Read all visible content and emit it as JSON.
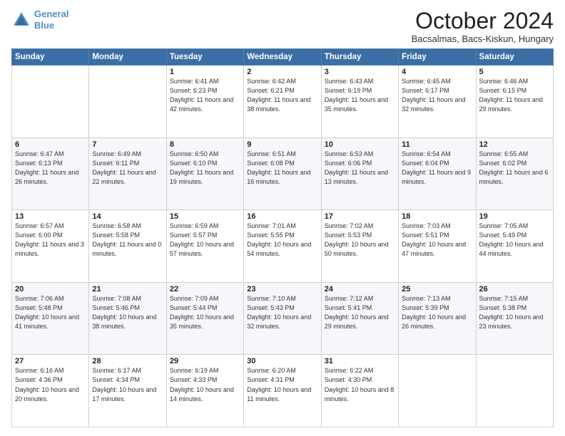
{
  "header": {
    "logo_line1": "General",
    "logo_line2": "Blue",
    "month": "October 2024",
    "location": "Bacsalmas, Bacs-Kiskun, Hungary"
  },
  "days_of_week": [
    "Sunday",
    "Monday",
    "Tuesday",
    "Wednesday",
    "Thursday",
    "Friday",
    "Saturday"
  ],
  "weeks": [
    [
      {
        "day": "",
        "text": ""
      },
      {
        "day": "",
        "text": ""
      },
      {
        "day": "1",
        "text": "Sunrise: 6:41 AM\nSunset: 6:23 PM\nDaylight: 11 hours and 42 minutes."
      },
      {
        "day": "2",
        "text": "Sunrise: 6:42 AM\nSunset: 6:21 PM\nDaylight: 11 hours and 38 minutes."
      },
      {
        "day": "3",
        "text": "Sunrise: 6:43 AM\nSunset: 6:19 PM\nDaylight: 11 hours and 35 minutes."
      },
      {
        "day": "4",
        "text": "Sunrise: 6:45 AM\nSunset: 6:17 PM\nDaylight: 11 hours and 32 minutes."
      },
      {
        "day": "5",
        "text": "Sunrise: 6:46 AM\nSunset: 6:15 PM\nDaylight: 11 hours and 29 minutes."
      }
    ],
    [
      {
        "day": "6",
        "text": "Sunrise: 6:47 AM\nSunset: 6:13 PM\nDaylight: 11 hours and 26 minutes."
      },
      {
        "day": "7",
        "text": "Sunrise: 6:49 AM\nSunset: 6:11 PM\nDaylight: 11 hours and 22 minutes."
      },
      {
        "day": "8",
        "text": "Sunrise: 6:50 AM\nSunset: 6:10 PM\nDaylight: 11 hours and 19 minutes."
      },
      {
        "day": "9",
        "text": "Sunrise: 6:51 AM\nSunset: 6:08 PM\nDaylight: 11 hours and 16 minutes."
      },
      {
        "day": "10",
        "text": "Sunrise: 6:53 AM\nSunset: 6:06 PM\nDaylight: 11 hours and 13 minutes."
      },
      {
        "day": "11",
        "text": "Sunrise: 6:54 AM\nSunset: 6:04 PM\nDaylight: 11 hours and 9 minutes."
      },
      {
        "day": "12",
        "text": "Sunrise: 6:55 AM\nSunset: 6:02 PM\nDaylight: 11 hours and 6 minutes."
      }
    ],
    [
      {
        "day": "13",
        "text": "Sunrise: 6:57 AM\nSunset: 6:00 PM\nDaylight: 11 hours and 3 minutes."
      },
      {
        "day": "14",
        "text": "Sunrise: 6:58 AM\nSunset: 5:58 PM\nDaylight: 11 hours and 0 minutes."
      },
      {
        "day": "15",
        "text": "Sunrise: 6:59 AM\nSunset: 5:57 PM\nDaylight: 10 hours and 57 minutes."
      },
      {
        "day": "16",
        "text": "Sunrise: 7:01 AM\nSunset: 5:55 PM\nDaylight: 10 hours and 54 minutes."
      },
      {
        "day": "17",
        "text": "Sunrise: 7:02 AM\nSunset: 5:53 PM\nDaylight: 10 hours and 50 minutes."
      },
      {
        "day": "18",
        "text": "Sunrise: 7:03 AM\nSunset: 5:51 PM\nDaylight: 10 hours and 47 minutes."
      },
      {
        "day": "19",
        "text": "Sunrise: 7:05 AM\nSunset: 5:49 PM\nDaylight: 10 hours and 44 minutes."
      }
    ],
    [
      {
        "day": "20",
        "text": "Sunrise: 7:06 AM\nSunset: 5:48 PM\nDaylight: 10 hours and 41 minutes."
      },
      {
        "day": "21",
        "text": "Sunrise: 7:08 AM\nSunset: 5:46 PM\nDaylight: 10 hours and 38 minutes."
      },
      {
        "day": "22",
        "text": "Sunrise: 7:09 AM\nSunset: 5:44 PM\nDaylight: 10 hours and 35 minutes."
      },
      {
        "day": "23",
        "text": "Sunrise: 7:10 AM\nSunset: 5:43 PM\nDaylight: 10 hours and 32 minutes."
      },
      {
        "day": "24",
        "text": "Sunrise: 7:12 AM\nSunset: 5:41 PM\nDaylight: 10 hours and 29 minutes."
      },
      {
        "day": "25",
        "text": "Sunrise: 7:13 AM\nSunset: 5:39 PM\nDaylight: 10 hours and 26 minutes."
      },
      {
        "day": "26",
        "text": "Sunrise: 7:15 AM\nSunset: 5:38 PM\nDaylight: 10 hours and 23 minutes."
      }
    ],
    [
      {
        "day": "27",
        "text": "Sunrise: 6:16 AM\nSunset: 4:36 PM\nDaylight: 10 hours and 20 minutes."
      },
      {
        "day": "28",
        "text": "Sunrise: 6:17 AM\nSunset: 4:34 PM\nDaylight: 10 hours and 17 minutes."
      },
      {
        "day": "29",
        "text": "Sunrise: 6:19 AM\nSunset: 4:33 PM\nDaylight: 10 hours and 14 minutes."
      },
      {
        "day": "30",
        "text": "Sunrise: 6:20 AM\nSunset: 4:31 PM\nDaylight: 10 hours and 11 minutes."
      },
      {
        "day": "31",
        "text": "Sunrise: 6:22 AM\nSunset: 4:30 PM\nDaylight: 10 hours and 8 minutes."
      },
      {
        "day": "",
        "text": ""
      },
      {
        "day": "",
        "text": ""
      }
    ]
  ]
}
